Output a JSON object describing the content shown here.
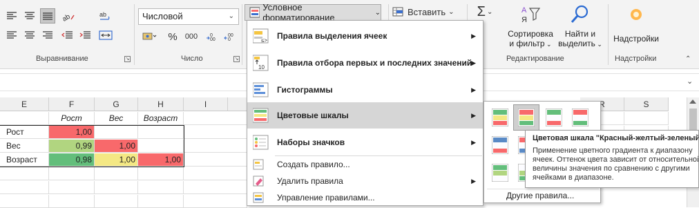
{
  "ribbon": {
    "number_format": "Числовой",
    "conditional_formatting": "Условное форматирование",
    "insert": "Вставить",
    "sort_label_1": "Сортировка",
    "sort_label_2": "и фильтр",
    "find_label_1": "Найти и",
    "find_label_2": "выделить",
    "addins_label": "Надстройки",
    "groups": {
      "alignment": "Выравнивание",
      "number": "Число",
      "editing": "Редактирование",
      "addins": "Надстройки"
    },
    "percent": "%",
    "thousands": "000"
  },
  "columns": [
    "E",
    "F",
    "G",
    "H",
    "I",
    "R",
    "S"
  ],
  "table": {
    "headers": [
      "Рост",
      "Вес",
      "Возраст"
    ],
    "rows": [
      {
        "label": "Рост",
        "values": [
          "1,00",
          "",
          ""
        ]
      },
      {
        "label": "Вес",
        "values": [
          "0,99",
          "1,00",
          ""
        ]
      },
      {
        "label": "Возраст",
        "values": [
          "0,98",
          "1,00",
          "1,00"
        ]
      }
    ]
  },
  "colors": {
    "red": "#f8696b",
    "light_green": "#b1d580",
    "yellow": "#f4e884",
    "green": "#63be7b",
    "accent_icon": "#217346",
    "hover_row": "#d6d6d6"
  },
  "menu": {
    "items": [
      {
        "label": "Правила выделения ячеек",
        "icon": "highlight-rules-icon"
      },
      {
        "label": "Правила отбора первых и последних значений",
        "icon": "top-bottom-icon"
      },
      {
        "label": "Гистограммы",
        "icon": "data-bars-icon"
      },
      {
        "label": "Цветовые шкалы",
        "icon": "color-scales-icon"
      },
      {
        "label": "Наборы значков",
        "icon": "icon-sets-icon"
      }
    ],
    "actions": [
      {
        "label": "Создать правило...",
        "icon": "new-rule-icon"
      },
      {
        "label": "Удалить правила",
        "icon": "clear-rules-icon"
      },
      {
        "label": "Управление правилами...",
        "icon": "manage-rules-icon"
      }
    ]
  },
  "submenu": {
    "more_rules": "Другие правила..."
  },
  "tooltip": {
    "title": "Цветовая шкала \"Красный-желтый-зеленый\"",
    "body": "Применение цветного градиента к диапазону ячеек. Оттенок цвета зависит от относительной величины значения по сравнению с другими ячейками в диапазоне."
  }
}
